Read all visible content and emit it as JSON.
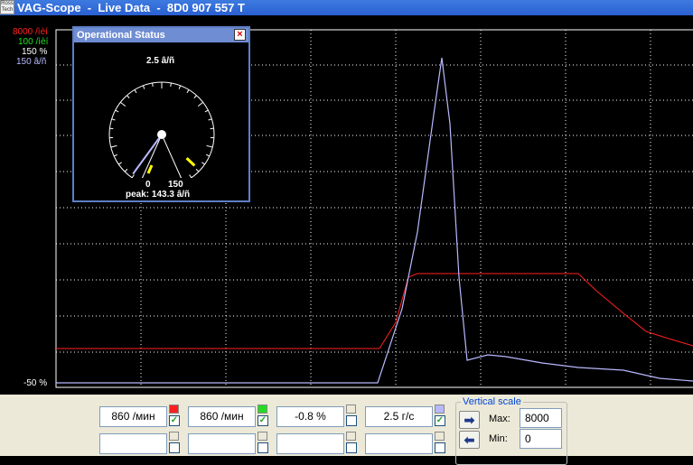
{
  "window": {
    "title": "VAG-Scope  -  Live Data  -  8D0 907 557 T",
    "icon_text": "Ross Tech"
  },
  "scale_labels": [
    {
      "text": "8000 /ìèí",
      "color": "#ff2020"
    },
    {
      "text": "100 /ìèí",
      "color": "#20e020"
    },
    {
      "text": "150 %",
      "color": "#ffffff"
    },
    {
      "text": "150 â/ñ",
      "color": "#b8b8ff"
    }
  ],
  "bottom_scale_label": "-50 %",
  "colors": {
    "red": "#ff2020",
    "green": "#22dd22",
    "blue": "#b8b8ff",
    "grid": "#ffffff"
  },
  "popup": {
    "title": "Operational Status",
    "close_icon": "close-icon",
    "gauge_top": "2.5 â/ñ",
    "gauge_min": "0",
    "gauge_max": "150",
    "peak": "peak: 143.3 â/ñ",
    "current_value": 2.5,
    "peak_value": 143.3,
    "range": [
      0,
      150
    ]
  },
  "channels": [
    {
      "value": "860 /мин",
      "checked": true,
      "color": "#ff2020"
    },
    {
      "value": "860 /мин",
      "checked": true,
      "color": "#22dd22"
    },
    {
      "value": "-0.8 %",
      "checked": false,
      "color": "#ffffff"
    },
    {
      "value": "2.5 г/с",
      "checked": true,
      "color": "#b8b8ff"
    }
  ],
  "channels_row2": [
    {
      "value": "",
      "checked": false
    },
    {
      "value": "",
      "checked": false
    },
    {
      "value": "",
      "checked": false
    },
    {
      "value": "",
      "checked": false
    }
  ],
  "vertical_scale": {
    "title": "Vertical scale",
    "max_label": "Max:",
    "max_value": "8000",
    "min_label": "Min:",
    "min_value": "0",
    "apply_icon": "arrow-right-icon",
    "reset_icon": "arrow-left-icon"
  },
  "check_mark": "✓"
}
